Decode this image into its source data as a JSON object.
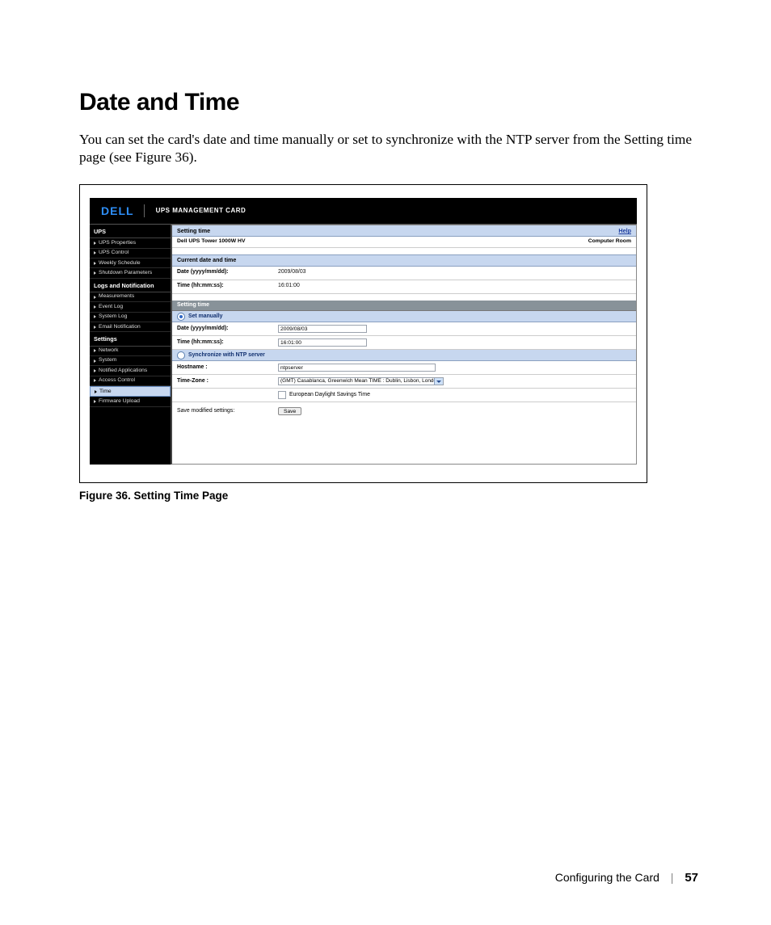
{
  "doc": {
    "heading": "Date and Time",
    "intro": "You can set the card's date and time manually or set to synchronize with the NTP server from the Setting time page (see Figure 36).",
    "caption": "Figure 36. Setting Time Page",
    "footer_section": "Configuring the Card",
    "footer_page": "57"
  },
  "header": {
    "logo": "DELL",
    "title": "UPS MANAGEMENT CARD"
  },
  "sidebar": {
    "sections": {
      "ups": "UPS",
      "logs": "Logs and Notification",
      "settings": "Settings"
    },
    "items": {
      "ups_properties": "UPS Properties",
      "ups_control": "UPS Control",
      "weekly_schedule": "Weekly Schedule",
      "shutdown_params": "Shutdown Parameters",
      "measurements": "Measurements",
      "event_log": "Event Log",
      "system_log": "System Log",
      "email_notification": "Email Notification",
      "network": "Network",
      "system": "System",
      "notified_apps": "Notified Applications",
      "access_control": "Access Control",
      "time": "Time",
      "firmware_upload": "Firmware Upload"
    }
  },
  "main": {
    "titlebar": "Setting time",
    "help": "Help",
    "device_name": "Dell UPS Tower 1000W HV",
    "location": "Computer Room",
    "section_current": "Current date and time",
    "label_date": "Date (yyyy/mm/dd):",
    "label_time": "Time (hh:mm:ss):",
    "current_date": "2009/08/03",
    "current_time": "16:01:00",
    "section_setting": "Setting time",
    "opt_manual": "Set manually",
    "manual_date": "2009/08/03",
    "manual_time": "16:01:00",
    "opt_ntp": "Synchronize with NTP server",
    "label_hostname": "Hostname :",
    "hostname_value": "ntpserver",
    "label_timezone": "Time-Zone :",
    "timezone_value": "(GMT) Casablanca, Greenwich Mean TIME : Dublin, Lisbon, London",
    "dst_label": "European Daylight Savings Time",
    "save_label": "Save modified settings:",
    "save_button": "Save"
  }
}
